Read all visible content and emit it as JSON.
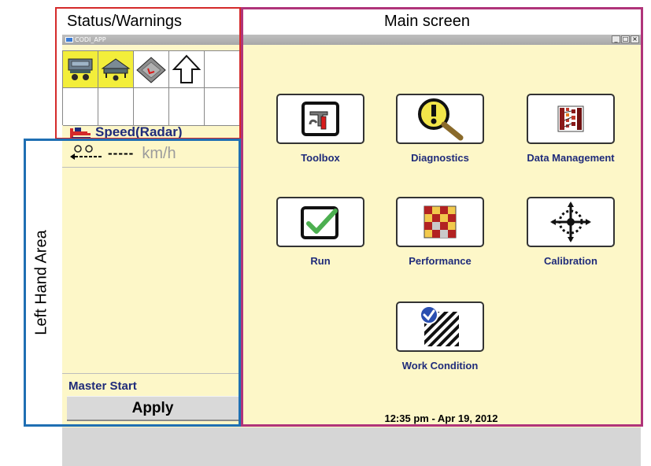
{
  "window": {
    "title": "CODI_APP",
    "controls": [
      "_",
      "□",
      "×"
    ]
  },
  "regions": {
    "status_title": "Status/Warnings",
    "main_title": "Main screen",
    "left_title": "Left Hand Area"
  },
  "status": {
    "icons": [
      "tractor-icon",
      "implement-icon",
      "seeder-icon",
      "arrow-up-icon"
    ],
    "highlight_color": "#f3ee3a"
  },
  "speed": {
    "label": "Speed(Radar)",
    "value": "-----",
    "unit": "km/h"
  },
  "left": {
    "master_label": "Master Start",
    "apply_label": "Apply"
  },
  "menu": {
    "toolbox": "Toolbox",
    "diagnostics": "Diagnostics",
    "data_management": "Data Management",
    "run": "Run",
    "performance": "Performance",
    "calibration": "Calibration",
    "work_condition": "Work Condition"
  },
  "datetime": "12:35 pm - Apr 19, 2012",
  "colors": {
    "panel_bg": "#fdf7c8",
    "label_blue": "#1f2b7a",
    "status_border": "#d42a2a",
    "main_border": "#b0347a",
    "left_border": "#1f6fb3"
  }
}
